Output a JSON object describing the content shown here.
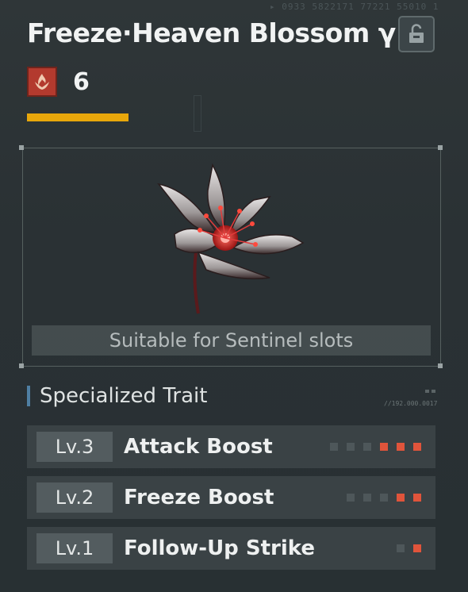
{
  "background": {
    "code_text": "▸ 0933 5822171 77221 55010 1"
  },
  "header": {
    "title": "Freeze·Heaven Blossom γ",
    "level": "6",
    "element_icon": "fire-element-icon",
    "lock_icon": "lock-open-icon",
    "accent_color": "#e8a70b"
  },
  "item": {
    "image": "red-white-lotus-flower-icon",
    "suitable_text": "Suitable for Sentinel slots"
  },
  "traits": {
    "heading": "Specialized Trait",
    "serial": "//192.000.0017",
    "items": [
      {
        "level": "Lv.3",
        "name": "Attack Boost",
        "pips_filled": 3,
        "pips_total": 6
      },
      {
        "level": "Lv.2",
        "name": "Freeze Boost",
        "pips_filled": 2,
        "pips_total": 5
      },
      {
        "level": "Lv.1",
        "name": "Follow-Up Strike",
        "pips_filled": 1,
        "pips_total": 2
      }
    ]
  },
  "colors": {
    "pip_active": "#e0543b",
    "pip_inactive": "#4e575a",
    "element_red": "#b33a2e"
  }
}
